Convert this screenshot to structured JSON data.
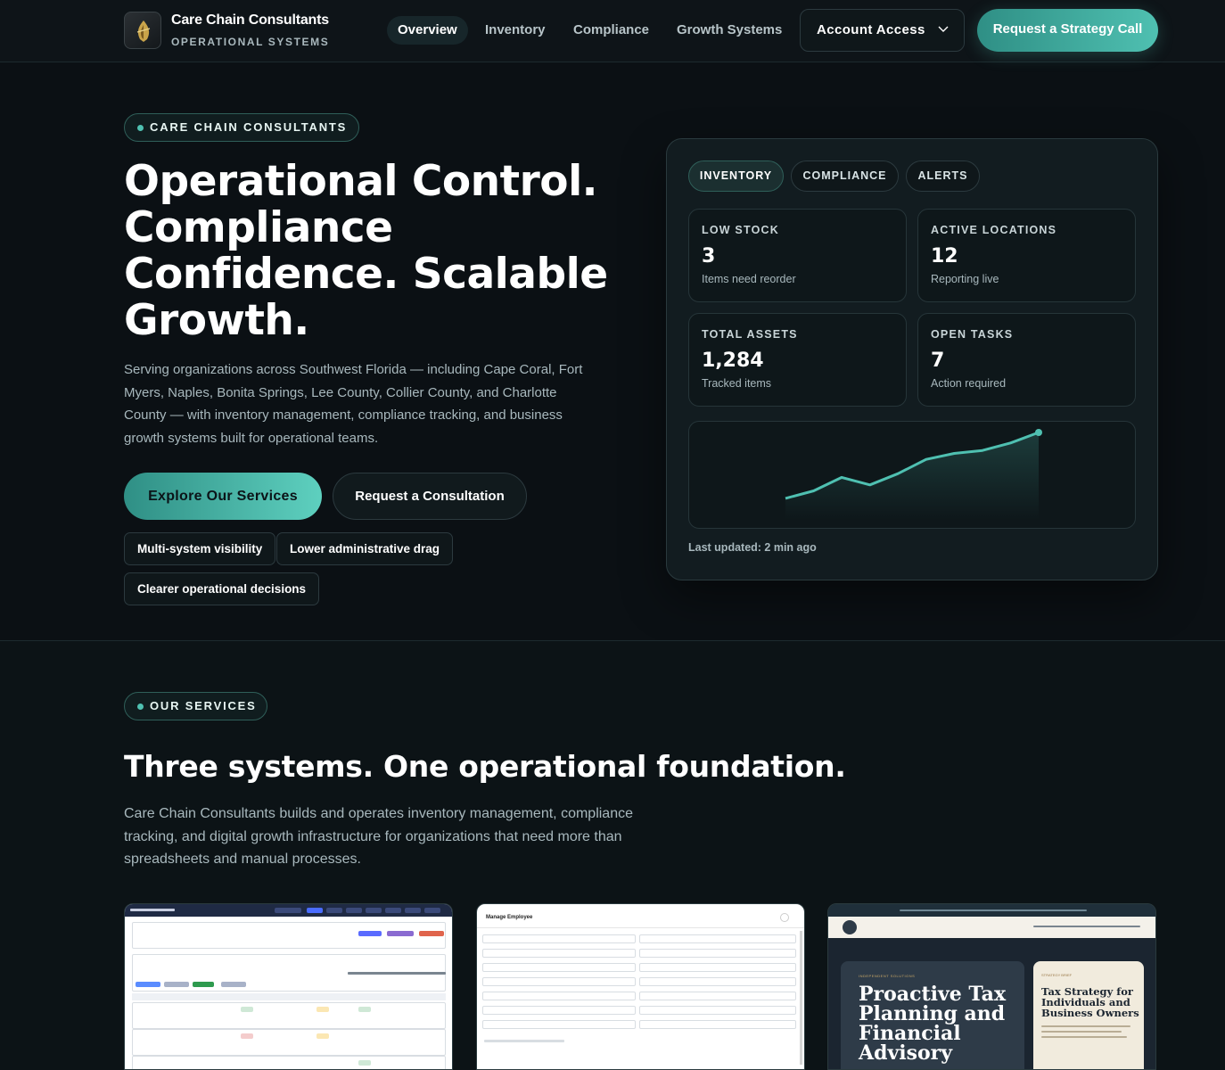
{
  "nav": {
    "brand_name": "Care Chain Consultants",
    "brand_sub": "OPERATIONAL SYSTEMS",
    "links": [
      "Overview",
      "Inventory",
      "Compliance",
      "Growth Systems"
    ],
    "account": "Account Access",
    "cta": "Request a Strategy Call"
  },
  "hero": {
    "eyebrow": "CARE CHAIN CONSULTANTS",
    "title": "Operational Control. Compliance Confidence. Scalable Growth.",
    "description": "Serving organizations across Southwest Florida — including Cape Coral, Fort Myers, Naples, Bonita Springs, Lee County, Collier County, and Charlotte County — with inventory management, compliance tracking, and business growth systems built for operational teams.",
    "primary_button": "Explore Our Services",
    "secondary_button": "Request a Consultation",
    "chips": [
      "Multi-system visibility",
      "Lower administrative drag",
      "Clearer operational decisions"
    ]
  },
  "dashboard": {
    "tabs": [
      "INVENTORY",
      "COMPLIANCE",
      "ALERTS"
    ],
    "stats": [
      {
        "label": "LOW STOCK",
        "value": "3",
        "note": "Items need reorder"
      },
      {
        "label": "ACTIVE LOCATIONS",
        "value": "12",
        "note": "Reporting live"
      },
      {
        "label": "TOTAL ASSETS",
        "value": "1,284",
        "note": "Tracked items"
      },
      {
        "label": "OPEN TASKS",
        "value": "7",
        "note": "Action required"
      }
    ],
    "trend": [
      0.12,
      0.22,
      0.4,
      0.3,
      0.45,
      0.64,
      0.72,
      0.76,
      0.86,
      1.0
    ],
    "updated": "Last updated: 2 min ago"
  },
  "services": {
    "eyebrow": "OUR SERVICES",
    "title": "Three systems. One operational foundation.",
    "description": "Care Chain Consultants builds and operates inventory management, compliance tracking, and digital growth infrastructure for organizations that need more than spreadsheets and manual processes.",
    "thumb2_title": "Manage Employee",
    "thumb3_small": "INDEPENDENT SOLUTIONS",
    "thumb3_heading": "Proactive Tax Planning and Financial Advisory",
    "thumb3_card_small": "STRATEGY BRIEF",
    "thumb3_card_title": "Tax Strategy for Individuals and Business Owners"
  },
  "colors": {
    "accent": "#4fc0b1",
    "background": "#0b1014",
    "card": "#121c20"
  }
}
